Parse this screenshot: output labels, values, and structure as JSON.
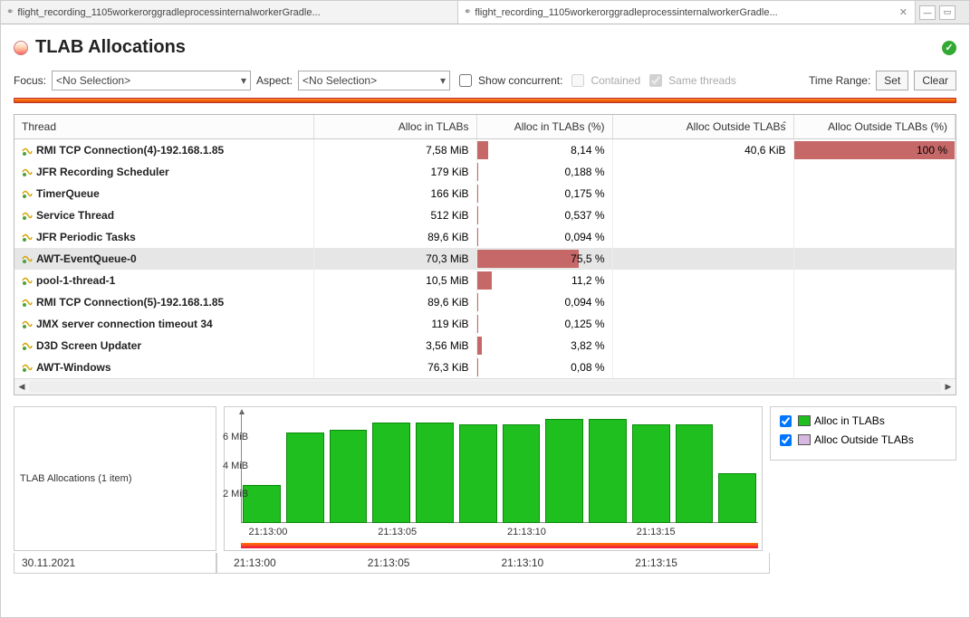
{
  "tabs": [
    {
      "label": "flight_recording_1105workerorggradleprocessinternalworkerGradle...",
      "active": false
    },
    {
      "label": "flight_recording_1105workerorggradleprocessinternalworkerGradle...",
      "active": true
    }
  ],
  "page_title": "TLAB Allocations",
  "toolbar": {
    "focus_label": "Focus:",
    "focus_value": "<No Selection>",
    "aspect_label": "Aspect:",
    "aspect_value": "<No Selection>",
    "show_concurrent": "Show concurrent:",
    "contained": "Contained",
    "same_threads": "Same threads",
    "time_range": "Time Range:",
    "set": "Set",
    "clear": "Clear"
  },
  "columns": {
    "thread": "Thread",
    "alloc_in": "Alloc in TLABs",
    "alloc_in_pct": "Alloc in TLABs (%)",
    "alloc_out": "Alloc Outside TLABs",
    "alloc_out_pct": "Alloc Outside TLABs (%)"
  },
  "rows": [
    {
      "thread": "RMI TCP Connection(4)-192.168.1.85",
      "in": "7,58 MiB",
      "in_pct": "8,14 %",
      "in_bar": 8.14,
      "out": "40,6 KiB",
      "out_pct": "100 %",
      "out_bar": 100,
      "sel": false
    },
    {
      "thread": "JFR Recording Scheduler",
      "in": "179 KiB",
      "in_pct": "0,188 %",
      "in_bar": 0.19,
      "out": "",
      "out_pct": "",
      "out_bar": 0,
      "sel": false
    },
    {
      "thread": "TimerQueue",
      "in": "166 KiB",
      "in_pct": "0,175 %",
      "in_bar": 0.18,
      "out": "",
      "out_pct": "",
      "out_bar": 0,
      "sel": false
    },
    {
      "thread": "Service Thread",
      "in": "512 KiB",
      "in_pct": "0,537 %",
      "in_bar": 0.54,
      "out": "",
      "out_pct": "",
      "out_bar": 0,
      "sel": false
    },
    {
      "thread": "JFR Periodic Tasks",
      "in": "89,6 KiB",
      "in_pct": "0,094 %",
      "in_bar": 0.09,
      "out": "",
      "out_pct": "",
      "out_bar": 0,
      "sel": false
    },
    {
      "thread": "AWT-EventQueue-0",
      "in": "70,3 MiB",
      "in_pct": "75,5 %",
      "in_bar": 75.5,
      "out": "",
      "out_pct": "",
      "out_bar": 0,
      "sel": true
    },
    {
      "thread": "pool-1-thread-1",
      "in": "10,5 MiB",
      "in_pct": "11,2 %",
      "in_bar": 11.2,
      "out": "",
      "out_pct": "",
      "out_bar": 0,
      "sel": false
    },
    {
      "thread": "RMI TCP Connection(5)-192.168.1.85",
      "in": "89,6 KiB",
      "in_pct": "0,094 %",
      "in_bar": 0.09,
      "out": "",
      "out_pct": "",
      "out_bar": 0,
      "sel": false
    },
    {
      "thread": "JMX server connection timeout 34",
      "in": "119 KiB",
      "in_pct": "0,125 %",
      "in_bar": 0.13,
      "out": "",
      "out_pct": "",
      "out_bar": 0,
      "sel": false
    },
    {
      "thread": "D3D Screen Updater",
      "in": "3,56 MiB",
      "in_pct": "3,82 %",
      "in_bar": 3.82,
      "out": "",
      "out_pct": "",
      "out_bar": 0,
      "sel": false
    },
    {
      "thread": "AWT-Windows",
      "in": "76,3 KiB",
      "in_pct": "0,08 %",
      "in_bar": 0.08,
      "out": "",
      "out_pct": "",
      "out_bar": 0,
      "sel": false
    }
  ],
  "chart": {
    "side_label": "TLAB Allocations (1 item)",
    "yticks": [
      "6 MiB",
      "4 MiB",
      "2 MiB"
    ],
    "date": "30.11.2021",
    "xticks": [
      "21:13:00",
      "21:13:05",
      "21:13:10",
      "21:13:15"
    ],
    "legend": {
      "a": "Alloc in TLABs",
      "b": "Alloc Outside TLABs"
    }
  },
  "chart_data": {
    "type": "bar",
    "title": "TLAB Allocations",
    "y_unit": "MiB",
    "y_ticks": [
      2,
      4,
      6
    ],
    "x_time_ticks": [
      "21:13:00",
      "21:13:05",
      "21:13:10",
      "21:13:15"
    ],
    "date": "30.11.2021",
    "series": [
      {
        "name": "Alloc in TLABs",
        "color": "#1fbf1f",
        "values": [
          2.7,
          6.4,
          6.6,
          7.1,
          7.1,
          7.0,
          7.0,
          7.4,
          7.4,
          7.0,
          7.0,
          3.5
        ]
      },
      {
        "name": "Alloc Outside TLABs",
        "color": "#d6b8e0",
        "values": [
          0,
          0,
          0,
          0,
          0,
          0,
          0,
          0,
          0,
          0,
          0,
          0
        ]
      }
    ],
    "ylim": [
      0,
      8
    ]
  }
}
